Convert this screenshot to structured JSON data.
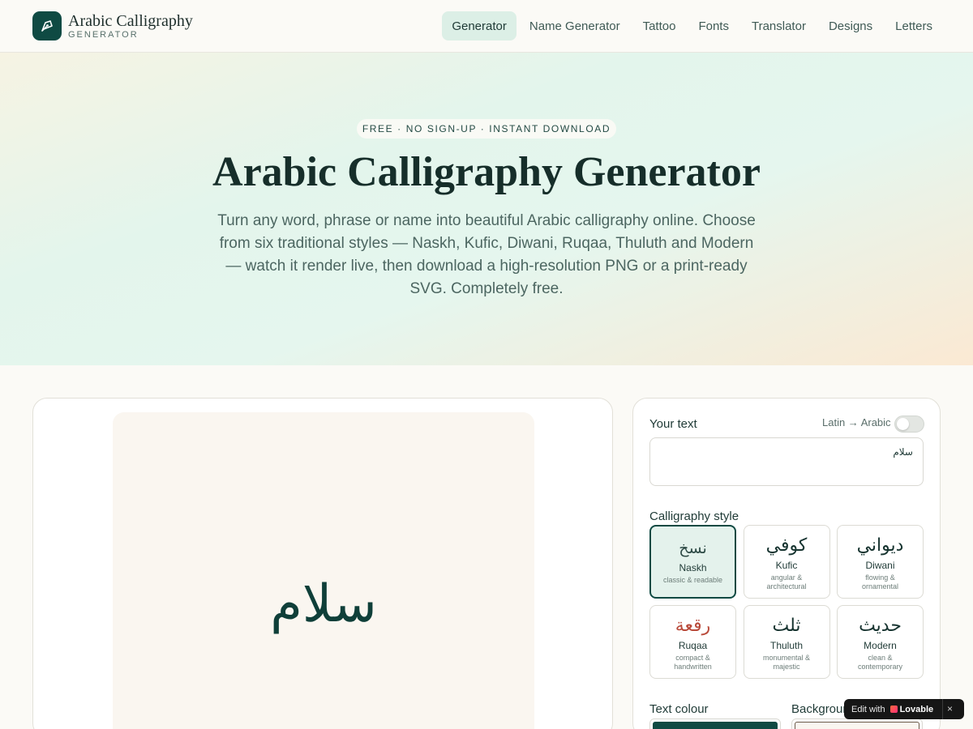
{
  "header": {
    "logo_title": "Arabic Calligraphy",
    "logo_subtitle": "GENERATOR",
    "nav": [
      {
        "label": "Generator",
        "active": true
      },
      {
        "label": "Name Generator"
      },
      {
        "label": "Tattoo"
      },
      {
        "label": "Fonts"
      },
      {
        "label": "Translator"
      },
      {
        "label": "Designs"
      },
      {
        "label": "Letters"
      }
    ]
  },
  "hero": {
    "pill": "FREE · NO SIGN-UP · INSTANT DOWNLOAD",
    "title": "Arabic Calligraphy Generator",
    "description": "Turn any word, phrase or name into beautiful Arabic calligraphy online. Choose from six traditional styles — Naskh, Kufic, Diwani, Ruqaa, Thuluth and Modern — watch it render live, then download a high-resolution PNG or a print-ready SVG. Completely free."
  },
  "preview": {
    "text": "سلام"
  },
  "controls": {
    "your_text_label": "Your text",
    "toggle_label": "Latin → Arabic",
    "toggle_on": false,
    "input_value": "سلام",
    "style_label": "Calligraphy style",
    "styles": [
      {
        "glyph": "نسخ",
        "name": "Naskh",
        "desc": "classic & readable",
        "selected": true
      },
      {
        "glyph": "كوفي",
        "name": "Kufic",
        "desc": "angular & architectural"
      },
      {
        "glyph": "ديواني",
        "name": "Diwani",
        "desc": "flowing & ornamental"
      },
      {
        "glyph": "رقعة",
        "name": "Ruqaa",
        "desc": "compact & handwritten"
      },
      {
        "glyph": "ثلث",
        "name": "Thuluth",
        "desc": "monumental & majestic"
      },
      {
        "glyph": "حديث",
        "name": "Modern",
        "desc": "clean & contemporary"
      }
    ],
    "text_colour_label": "Text colour",
    "background_label": "Background",
    "text_colour": "#0f4a43",
    "background_colour": "#faf6f0"
  },
  "badge": {
    "edit": "Edit with",
    "brand": "Lovable",
    "close": "×"
  },
  "colors": {
    "brand": "#0f4a43",
    "nav_active_bg": "#dcefe6",
    "ruqaa_accent": "#b94a3a"
  }
}
